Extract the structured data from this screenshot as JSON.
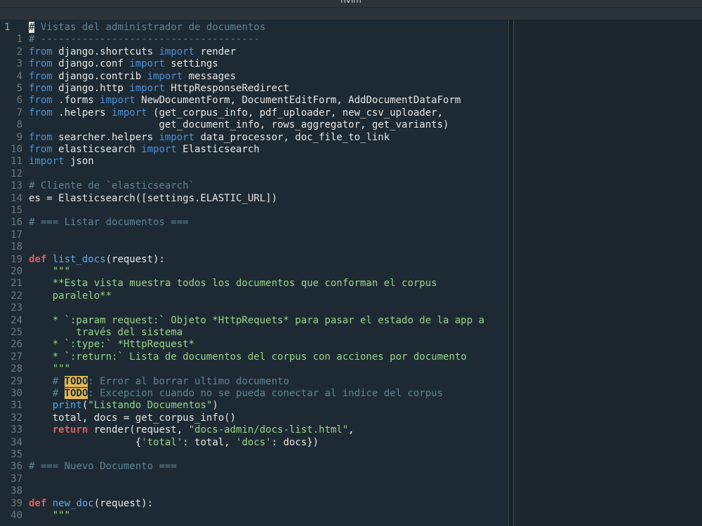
{
  "window": {
    "title": "nvim"
  },
  "editor": {
    "lines": [
      {
        "n": "1",
        "current": true,
        "segs": [
          [
            "cursor",
            "#"
          ],
          [
            "cm",
            " Vistas del administrador de documentos"
          ]
        ]
      },
      {
        "n": "1",
        "segs": [
          [
            "cm",
            "# -------------------------------------"
          ]
        ]
      },
      {
        "n": "2",
        "segs": [
          [
            "imp",
            "from"
          ],
          [
            "t",
            " django.shortcuts "
          ],
          [
            "imp",
            "import"
          ],
          [
            "t",
            " render"
          ]
        ]
      },
      {
        "n": "3",
        "segs": [
          [
            "imp",
            "from"
          ],
          [
            "t",
            " django.conf "
          ],
          [
            "imp",
            "import"
          ],
          [
            "t",
            " settings"
          ]
        ]
      },
      {
        "n": "4",
        "segs": [
          [
            "imp",
            "from"
          ],
          [
            "t",
            " django.contrib "
          ],
          [
            "imp",
            "import"
          ],
          [
            "t",
            " messages"
          ]
        ]
      },
      {
        "n": "5",
        "segs": [
          [
            "imp",
            "from"
          ],
          [
            "t",
            " django.http "
          ],
          [
            "imp",
            "import"
          ],
          [
            "t",
            " HttpResponseRedirect"
          ]
        ]
      },
      {
        "n": "6",
        "segs": [
          [
            "imp",
            "from"
          ],
          [
            "t",
            " .forms "
          ],
          [
            "imp",
            "import"
          ],
          [
            "t",
            " NewDocumentForm, DocumentEditForm, AddDocumentDataForm"
          ]
        ]
      },
      {
        "n": "7",
        "segs": [
          [
            "imp",
            "from"
          ],
          [
            "t",
            " .helpers "
          ],
          [
            "imp",
            "import"
          ],
          [
            "t",
            " (get_corpus_info, pdf_uploader, new_csv_uploader,"
          ]
        ]
      },
      {
        "n": "8",
        "segs": [
          [
            "t",
            "                      get_document_info, rows_aggregator, get_variants)"
          ]
        ]
      },
      {
        "n": "9",
        "segs": [
          [
            "imp",
            "from"
          ],
          [
            "t",
            " searcher.helpers "
          ],
          [
            "imp",
            "import"
          ],
          [
            "t",
            " data_processor, doc_file_to_link"
          ]
        ]
      },
      {
        "n": "10",
        "segs": [
          [
            "imp",
            "from"
          ],
          [
            "t",
            " elasticsearch "
          ],
          [
            "imp",
            "import"
          ],
          [
            "t",
            " Elasticsearch"
          ]
        ]
      },
      {
        "n": "11",
        "segs": [
          [
            "imp",
            "import"
          ],
          [
            "t",
            " json"
          ]
        ]
      },
      {
        "n": "12",
        "segs": []
      },
      {
        "n": "13",
        "segs": [
          [
            "cm",
            "# Cliente de `elasticsearch`"
          ]
        ]
      },
      {
        "n": "14",
        "segs": [
          [
            "t",
            "es = Elasticsearch([settings.ELASTIC_URL])"
          ]
        ]
      },
      {
        "n": "15",
        "segs": []
      },
      {
        "n": "16",
        "segs": [
          [
            "cm",
            "# === Listar documentos ==="
          ]
        ]
      },
      {
        "n": "17",
        "segs": []
      },
      {
        "n": "18",
        "segs": []
      },
      {
        "n": "19",
        "segs": [
          [
            "kw",
            "def"
          ],
          [
            "t",
            " "
          ],
          [
            "fn",
            "list_docs"
          ],
          [
            "t",
            "(request):"
          ]
        ]
      },
      {
        "n": "20",
        "segs": [
          [
            "t",
            "    "
          ],
          [
            "str",
            "\"\"\""
          ]
        ]
      },
      {
        "n": "21",
        "segs": [
          [
            "str",
            "    **Esta vista muestra todos los documentos que conforman el corpus"
          ]
        ]
      },
      {
        "n": "22",
        "segs": [
          [
            "str",
            "    paralelo**"
          ]
        ]
      },
      {
        "n": "23",
        "segs": []
      },
      {
        "n": "24",
        "segs": [
          [
            "str",
            "    * `:param request:` Objeto *HttpRequets* para pasar el estado de la app a"
          ]
        ]
      },
      {
        "n": "25",
        "segs": [
          [
            "str",
            "        través del sistema"
          ]
        ]
      },
      {
        "n": "26",
        "segs": [
          [
            "str",
            "    * `:type:` *HttpRequest*"
          ]
        ]
      },
      {
        "n": "27",
        "segs": [
          [
            "str",
            "    * `:return:` Lista de documentos del corpus con acciones por documento"
          ]
        ]
      },
      {
        "n": "28",
        "segs": [
          [
            "str",
            "    \"\"\""
          ]
        ]
      },
      {
        "n": "29",
        "segs": [
          [
            "t",
            "    "
          ],
          [
            "cm",
            "# "
          ],
          [
            "todo",
            "TODO"
          ],
          [
            "cm",
            ": Error al borrar ultimo documento"
          ]
        ]
      },
      {
        "n": "30",
        "segs": [
          [
            "t",
            "    "
          ],
          [
            "cm",
            "# "
          ],
          [
            "todo",
            "TODO"
          ],
          [
            "cm",
            ": Excepcion cuando no se pueda conectar al indice del corpus"
          ]
        ]
      },
      {
        "n": "31",
        "segs": [
          [
            "t",
            "    "
          ],
          [
            "bi",
            "print"
          ],
          [
            "t",
            "("
          ],
          [
            "str",
            "\"Listando Documentos\""
          ],
          [
            "t",
            ")"
          ]
        ]
      },
      {
        "n": "32",
        "segs": [
          [
            "t",
            "    total, docs = get_corpus_info()"
          ]
        ]
      },
      {
        "n": "33",
        "segs": [
          [
            "t",
            "    "
          ],
          [
            "kw",
            "return"
          ],
          [
            "t",
            " render(request, "
          ],
          [
            "str",
            "\"docs-admin/docs-list.html\""
          ],
          [
            "t",
            ","
          ]
        ]
      },
      {
        "n": "34",
        "segs": [
          [
            "t",
            "                  {"
          ],
          [
            "str",
            "'total'"
          ],
          [
            "t",
            ": total, "
          ],
          [
            "str",
            "'docs'"
          ],
          [
            "t",
            ": docs})"
          ]
        ]
      },
      {
        "n": "35",
        "segs": []
      },
      {
        "n": "36",
        "segs": [
          [
            "cm",
            "# === Nuevo Documento ==="
          ]
        ]
      },
      {
        "n": "37",
        "segs": []
      },
      {
        "n": "38",
        "segs": []
      },
      {
        "n": "39",
        "segs": [
          [
            "kw",
            "def"
          ],
          [
            "t",
            " "
          ],
          [
            "fn",
            "new_doc"
          ],
          [
            "t",
            "(request):"
          ]
        ]
      },
      {
        "n": "40",
        "segs": [
          [
            "t",
            "    "
          ],
          [
            "str",
            "\"\"\""
          ]
        ]
      }
    ]
  }
}
